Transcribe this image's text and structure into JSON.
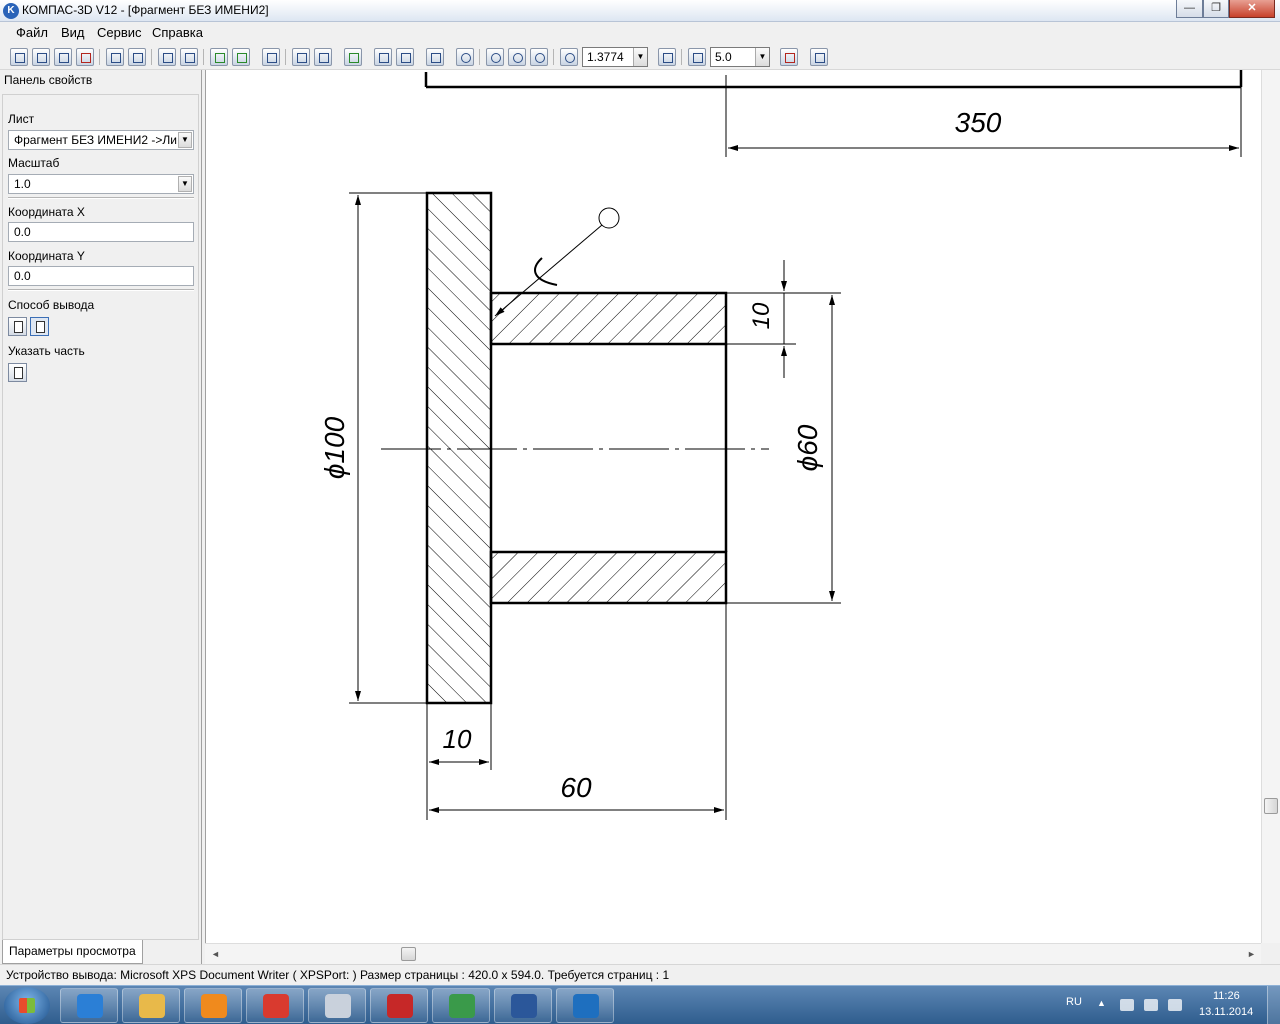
{
  "window": {
    "title": "КОМПАС-3D V12 - [Фрагмент БЕЗ ИМЕНИ2]",
    "logo_letter": "K",
    "minimize": "—",
    "restore": "❐",
    "close": "✕"
  },
  "menu": [
    "Файл",
    "Вид",
    "Сервис",
    "Справка"
  ],
  "toolbar": {
    "zoom_value": "1.3774",
    "step_value": "5.0"
  },
  "panel": {
    "title": "Панель свойств",
    "sheet_label": "Лист",
    "sheet_value": "Фрагмент БЕЗ ИМЕНИ2 ->Ли",
    "scale_label": "Масштаб",
    "scale_value": "1.0",
    "x_label": "Координата X",
    "x_value": "0.0",
    "y_label": "Координата Y",
    "y_value": "0.0",
    "output_label": "Способ вывода",
    "part_label": "Указать часть",
    "tab_label": "Параметры просмотра"
  },
  "drawing": {
    "dim_350": "350",
    "dim_d100": "ϕ100",
    "dim_d60": "ϕ60",
    "dim_10_top": "10",
    "dim_10_bottom": "10",
    "dim_60": "60"
  },
  "status": {
    "text": "Устройство вывода: Microsoft XPS Document Writer ( XPSPort: )  Размер страницы : 420.0 x 594.0.  Требуется страниц : 1"
  },
  "taskbar": {
    "apps": [
      {
        "name": "internet-explorer",
        "color": "#2b7fd6"
      },
      {
        "name": "file-explorer",
        "color": "#e8b94a"
      },
      {
        "name": "media-player",
        "color": "#f08a1d"
      },
      {
        "name": "chrome",
        "color": "#d93a2f"
      },
      {
        "name": "calculator",
        "color": "#c9d1dc"
      },
      {
        "name": "solidworks",
        "color": "#c62828"
      },
      {
        "name": "kompas-graphic",
        "color": "#3a9a4a"
      },
      {
        "name": "word",
        "color": "#2b579a"
      },
      {
        "name": "kompas-3d",
        "color": "#1e6fbf"
      }
    ],
    "language": "RU",
    "time": "11:26",
    "date": "13.11.2014"
  }
}
